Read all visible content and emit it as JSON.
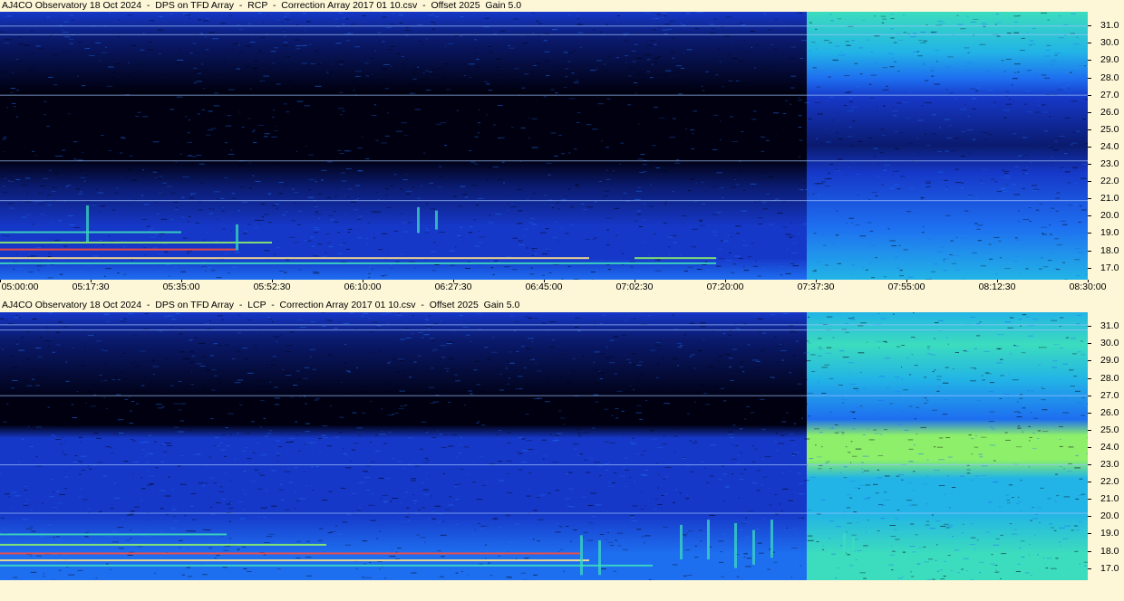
{
  "chart_data": [
    {
      "type": "heatmap",
      "title": "AJ4CO Observatory 18 Oct 2024  -  DPS on TFD Array  -  RCP  -  Correction Array 2017 01 10.csv  -  Offset 2025  Gain 5.0",
      "x_ticks": [
        "05:00:00",
        "05:17:30",
        "05:35:00",
        "05:52:30",
        "06:10:00",
        "06:27:30",
        "06:45:00",
        "07:02:30",
        "07:20:00",
        "07:37:30",
        "07:55:00",
        "08:12:30",
        "08:30:00"
      ],
      "y_ticks": [
        "31.0",
        "30.0",
        "29.0",
        "28.0",
        "27.0",
        "26.0",
        "25.0",
        "24.0",
        "23.0",
        "22.0",
        "21.0",
        "20.0",
        "19.0",
        "18.0",
        "17.0"
      ],
      "ylim": [
        16.3,
        31.8
      ],
      "xlim": [
        "05:00:00",
        "08:30:00"
      ],
      "colormap": [
        "#000010",
        "#0a1a6e",
        "#1638c8",
        "#1e6ef0",
        "#22b4e6",
        "#3cdcbe",
        "#8ef06a",
        "#ffe28a",
        "#ff4a3a"
      ]
    },
    {
      "type": "heatmap",
      "title": "AJ4CO Observatory 18 Oct 2024  -  DPS on TFD Array  -  LCP  -  Correction Array 2017 01 10.csv  -  Offset 2025  Gain 5.0",
      "x_ticks": [],
      "y_ticks": [
        "31.0",
        "30.0",
        "29.0",
        "28.0",
        "27.0",
        "26.0",
        "25.0",
        "24.0",
        "23.0",
        "22.0",
        "21.0",
        "20.0",
        "19.0",
        "18.0",
        "17.0"
      ],
      "ylim": [
        16.3,
        31.8
      ],
      "xlim": [
        "05:00:00",
        "08:30:00"
      ],
      "colormap": [
        "#000010",
        "#0a1a6e",
        "#1638c8",
        "#1e6ef0",
        "#22b4e6",
        "#3cdcbe",
        "#8ef06a",
        "#ffe28a",
        "#ff4a3a"
      ]
    }
  ]
}
